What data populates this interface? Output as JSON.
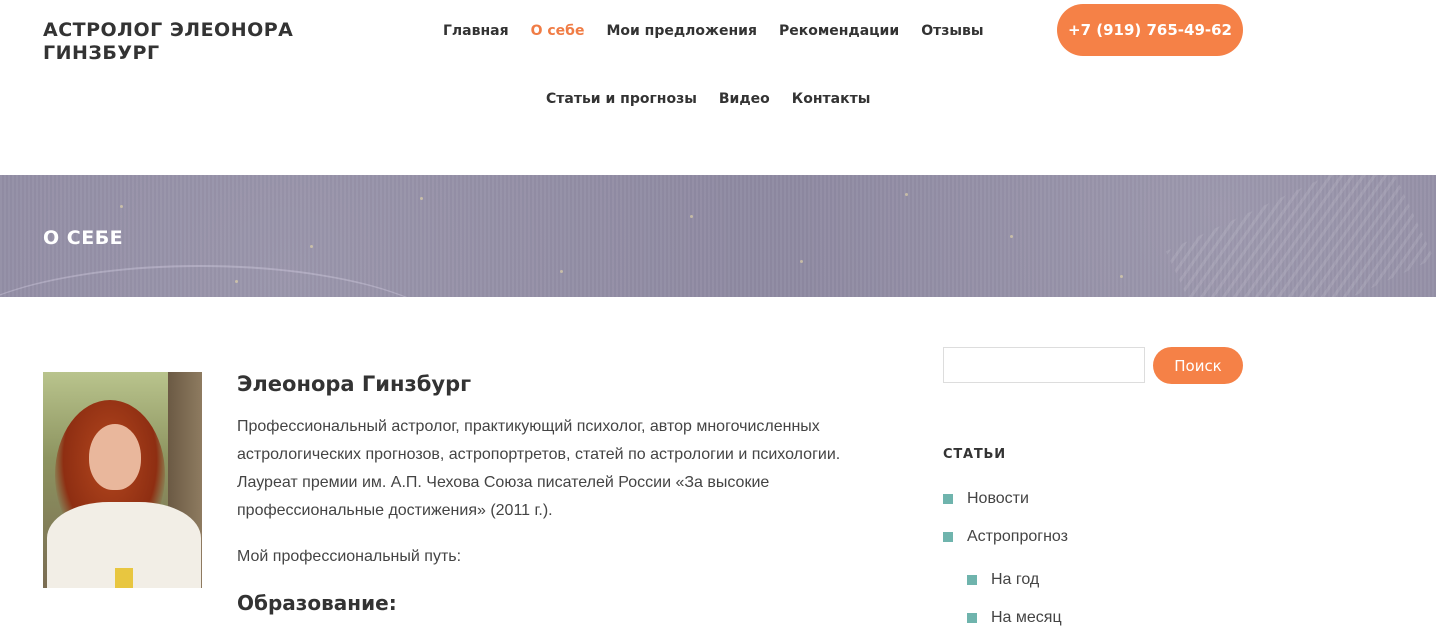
{
  "header": {
    "site_title": "АСТРОЛОГ ЭЛЕОНОРА ГИНЗБУРГ",
    "phone": "+7 (919) 765-49-62"
  },
  "nav": {
    "row1": [
      "Главная",
      "О себе",
      "Мои предложения",
      "Рекомендации",
      "Отзывы"
    ],
    "row2": [
      "Статьи и прогнозы",
      "Видео",
      "Контакты"
    ],
    "active": "О себе"
  },
  "banner": {
    "title": "О СЕБЕ"
  },
  "main": {
    "name": "Элеонора Гинзбург",
    "bio": "Профессиональный астролог, практикующий психолог, автор многочисленных астрологических прогнозов, астропортретов, статей по астрологии и психологии. Лауреат премии им. А.П. Чехова Союза писателей России «За высокие профессиональные достижения» (2011 г.).",
    "path_label": "Мой профессиональный путь:",
    "education_heading": "Образование:"
  },
  "sidebar": {
    "search_placeholder": "",
    "search_button": "Поиск",
    "widget_title": "СТАТЬИ",
    "categories": [
      {
        "label": "Новости",
        "level": 1
      },
      {
        "label": "Астропрогноз",
        "level": 1
      },
      {
        "label": "На год",
        "level": 2
      },
      {
        "label": "На месяц",
        "level": 2
      }
    ]
  },
  "colors": {
    "accent": "#f58147",
    "bullet": "#6fb4ad",
    "banner": "#8f8aa2",
    "text": "#333333"
  }
}
